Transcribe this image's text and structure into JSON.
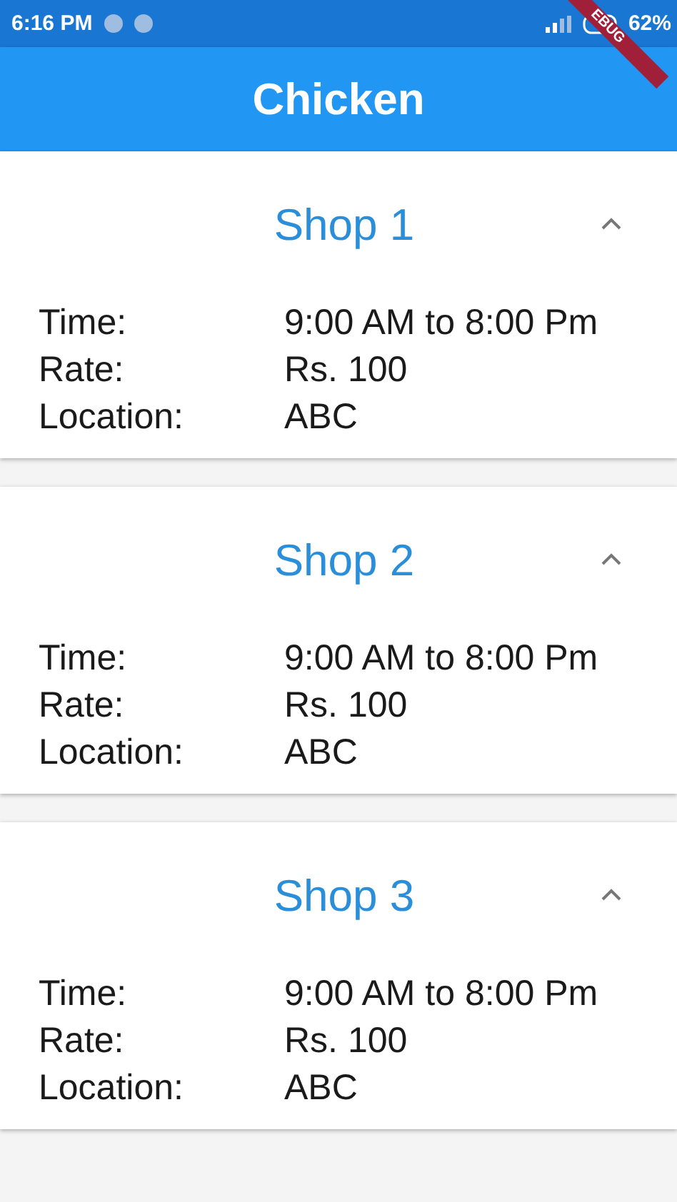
{
  "status_bar": {
    "time": "6:16 PM",
    "battery": "62%"
  },
  "debug_banner": "EBUG",
  "app_bar": {
    "title": "Chicken"
  },
  "shops": [
    {
      "title": "Shop 1",
      "expanded": true,
      "details": [
        {
          "label": "Time:",
          "value": "9:00 AM to 8:00 Pm"
        },
        {
          "label": "Rate:",
          "value": "Rs. 100"
        },
        {
          "label": "Location:",
          "value": "ABC"
        }
      ]
    },
    {
      "title": "Shop 2",
      "expanded": true,
      "details": [
        {
          "label": "Time:",
          "value": "9:00 AM to 8:00 Pm"
        },
        {
          "label": "Rate:",
          "value": "Rs. 100"
        },
        {
          "label": "Location:",
          "value": "ABC"
        }
      ]
    },
    {
      "title": "Shop 3",
      "expanded": true,
      "details": [
        {
          "label": "Time:",
          "value": "9:00 AM to 8:00 Pm"
        },
        {
          "label": "Rate:",
          "value": "Rs. 100"
        },
        {
          "label": "Location:",
          "value": "ABC"
        }
      ]
    }
  ]
}
